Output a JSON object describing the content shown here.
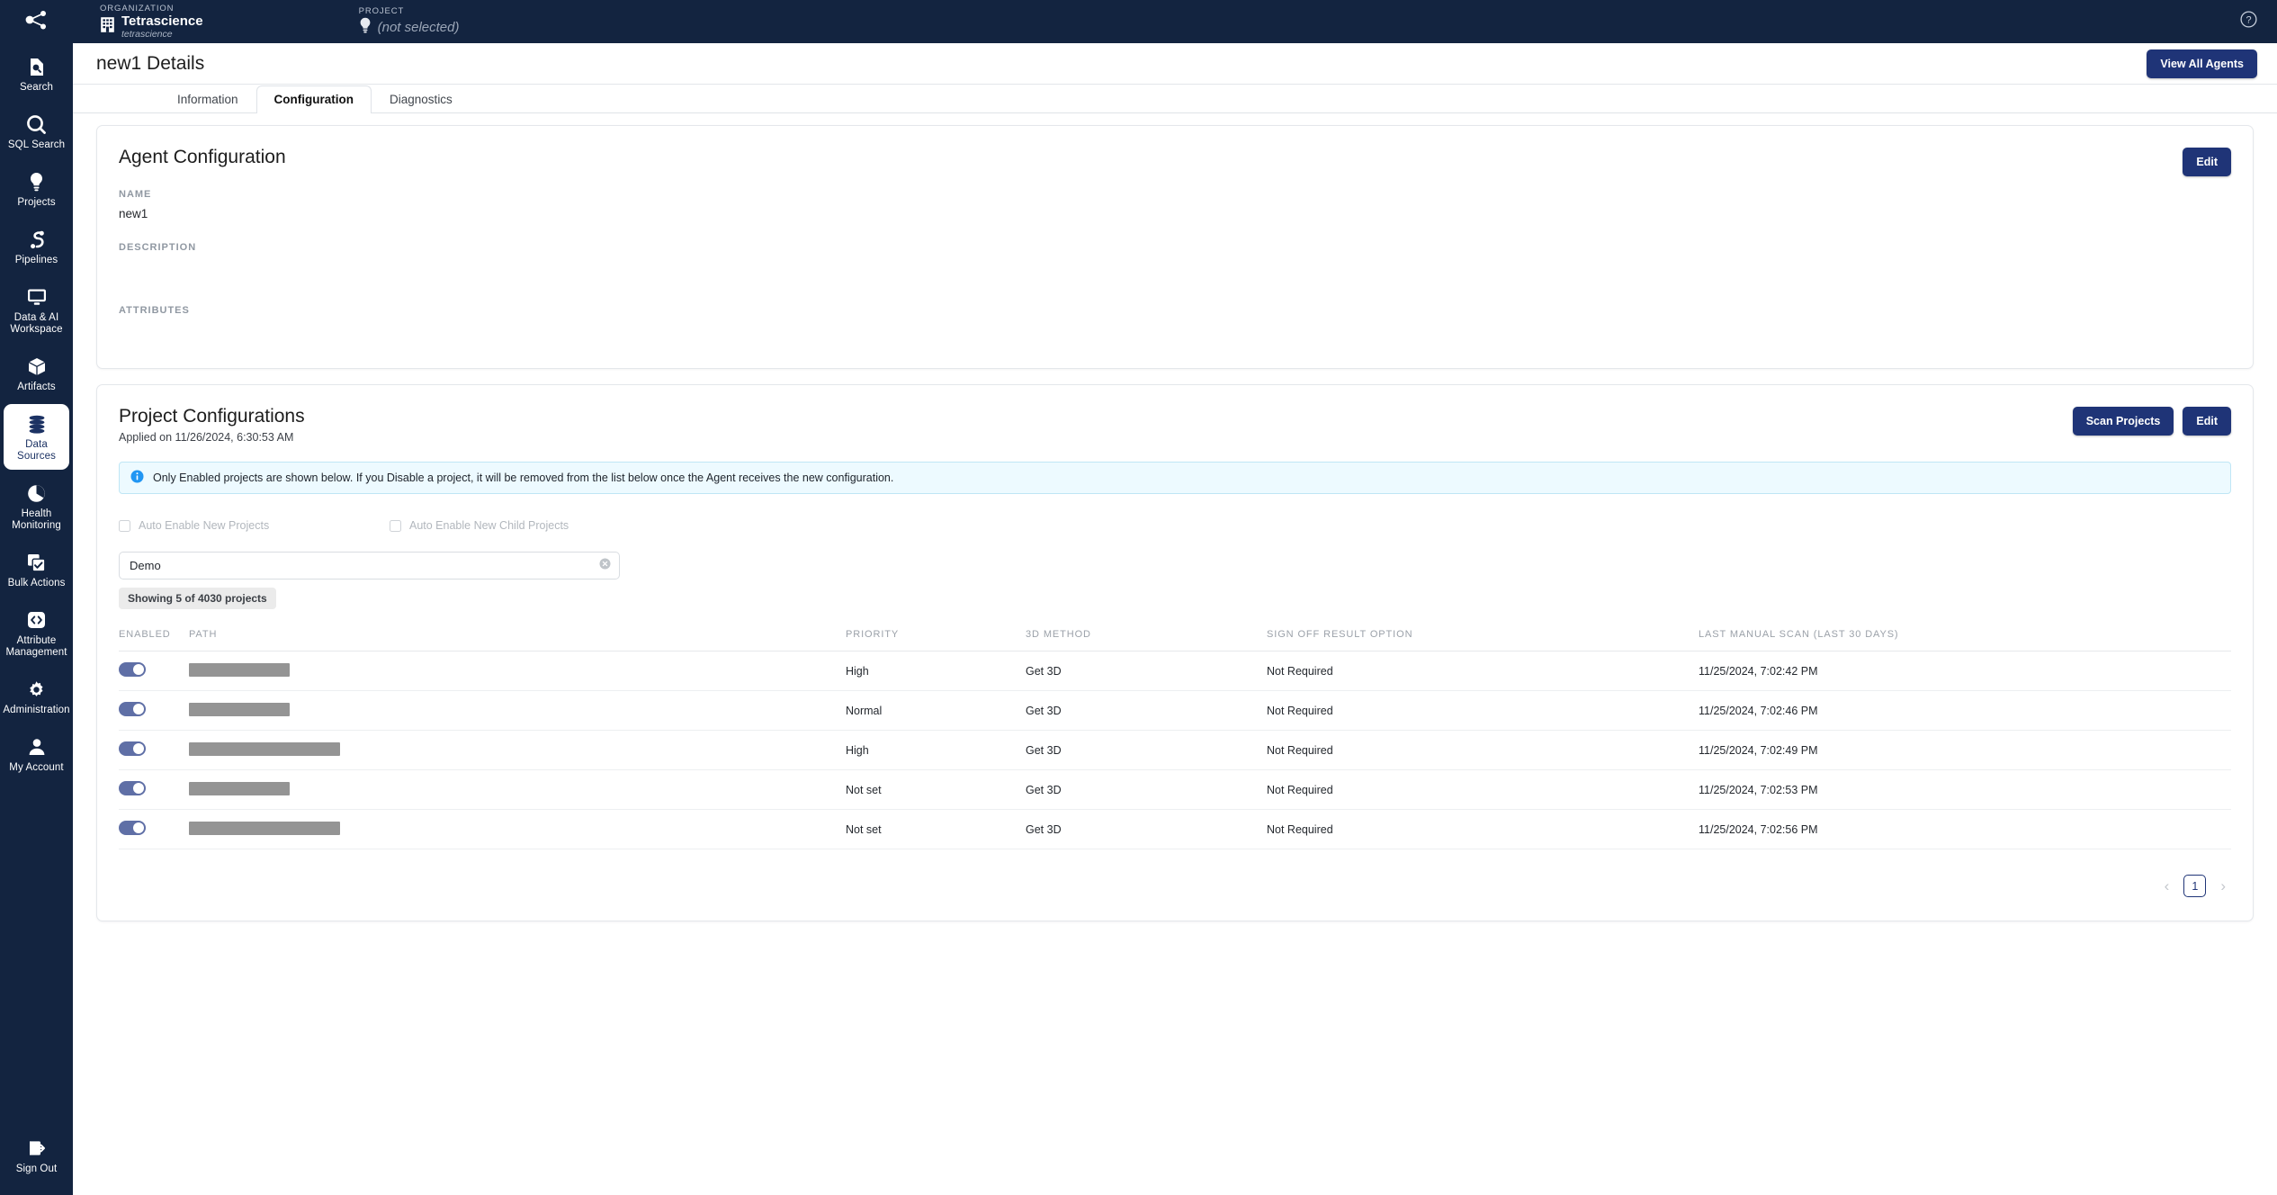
{
  "topbar": {
    "org": {
      "kicker": "ORGANIZATION",
      "name": "Tetrascience",
      "slug": "tetrascience",
      "icon": "building-icon"
    },
    "project": {
      "kicker": "PROJECT",
      "value": "(not selected)",
      "icon": "bulb-icon"
    },
    "help_icon": "help-circle-icon",
    "logo_icon": "tetrascience-logo-icon"
  },
  "sidebar": {
    "items": [
      {
        "label": "Search",
        "icon": "file-search-icon",
        "active": false
      },
      {
        "label": "SQL Search",
        "icon": "magnifier-icon",
        "active": false
      },
      {
        "label": "Projects",
        "icon": "bulb-icon",
        "active": false
      },
      {
        "label": "Pipelines",
        "icon": "pipeline-icon",
        "active": false
      },
      {
        "label": "Data & AI\nWorkspace",
        "icon": "monitor-icon",
        "active": false
      },
      {
        "label": "Artifacts",
        "icon": "cube-icon",
        "active": false
      },
      {
        "label": "Data Sources",
        "icon": "database-icon",
        "active": true
      },
      {
        "label": "Health\nMonitoring",
        "icon": "pie-chart-icon",
        "active": false
      },
      {
        "label": "Bulk Actions",
        "icon": "checked-copies-icon",
        "active": false
      },
      {
        "label": "Attribute\nManagement",
        "icon": "code-brackets-icon",
        "active": false
      },
      {
        "label": "Administration",
        "icon": "gear-icon",
        "active": false
      },
      {
        "label": "My Account",
        "icon": "user-icon",
        "active": false
      }
    ],
    "signout": {
      "label": "Sign Out",
      "icon": "sign-out-icon"
    }
  },
  "page": {
    "title": "new1 Details",
    "view_all_agents_label": "View All Agents"
  },
  "tabs": [
    {
      "label": "Information",
      "active": false
    },
    {
      "label": "Configuration",
      "active": true
    },
    {
      "label": "Diagnostics",
      "active": false
    }
  ],
  "agent_config": {
    "title": "Agent Configuration",
    "edit_label": "Edit",
    "fields": [
      {
        "label": "NAME",
        "value": "new1"
      },
      {
        "label": "DESCRIPTION",
        "value": ""
      },
      {
        "label": "ATTRIBUTES",
        "value": ""
      }
    ]
  },
  "project_config": {
    "title": "Project Configurations",
    "applied_on": "Applied on 11/26/2024, 6:30:53 AM",
    "scan_projects_label": "Scan Projects",
    "edit_label": "Edit",
    "info_banner": {
      "icon": "info-circle-icon",
      "text": "Only Enabled projects are shown below. If you Disable a project, it will be removed from the list below once the Agent receives the new configuration."
    },
    "checkboxes": [
      {
        "label": "Auto Enable New Projects",
        "checked": false
      },
      {
        "label": "Auto Enable New Child Projects",
        "checked": false
      }
    ],
    "search": {
      "value": "Demo",
      "placeholder": "",
      "clear_icon": "clear-circle-icon"
    },
    "showing_pill": "Showing 5 of 4030 projects",
    "table": {
      "columns": [
        "ENABLED",
        "PATH",
        "PRIORITY",
        "3D METHOD",
        "SIGN OFF RESULT OPTION",
        "LAST MANUAL SCAN (LAST 30 DAYS)"
      ],
      "rows": [
        {
          "enabled": true,
          "path_redacted_width": 112,
          "priority": "High",
          "method_3d": "Get 3D",
          "sign_off": "Not Required",
          "last_scan": "11/25/2024, 7:02:42 PM"
        },
        {
          "enabled": true,
          "path_redacted_width": 112,
          "priority": "Normal",
          "method_3d": "Get 3D",
          "sign_off": "Not Required",
          "last_scan": "11/25/2024, 7:02:46 PM"
        },
        {
          "enabled": true,
          "path_redacted_width": 168,
          "priority": "High",
          "method_3d": "Get 3D",
          "sign_off": "Not Required",
          "last_scan": "11/25/2024, 7:02:49 PM"
        },
        {
          "enabled": true,
          "path_redacted_width": 112,
          "priority": "Not set",
          "method_3d": "Get 3D",
          "sign_off": "Not Required",
          "last_scan": "11/25/2024, 7:02:53 PM"
        },
        {
          "enabled": true,
          "path_redacted_width": 168,
          "priority": "Not set",
          "method_3d": "Get 3D",
          "sign_off": "Not Required",
          "last_scan": "11/25/2024, 7:02:56 PM"
        }
      ]
    },
    "pagination": {
      "prev_icon": "chevron-left-icon",
      "next_icon": "chevron-right-icon",
      "current_page": "1"
    }
  },
  "colors": {
    "brand_navy": "#132440",
    "accent_blue": "#1f3477",
    "toggle_on": "#5f6fa6",
    "info_banner_bg": "#edfaff"
  }
}
